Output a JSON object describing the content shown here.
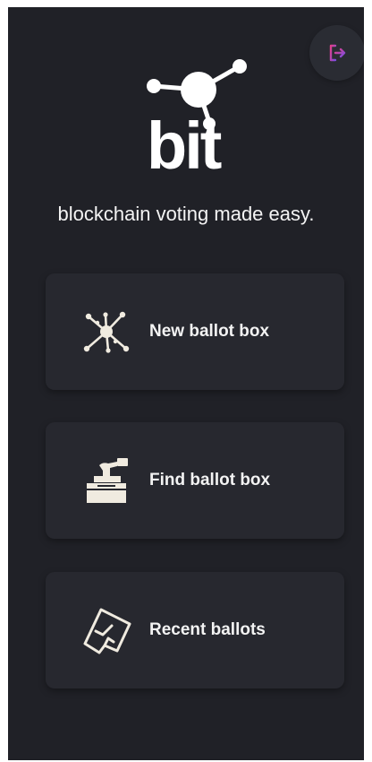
{
  "header": {
    "logout_icon": "logout-icon",
    "accent_colors": [
      "#e0408a",
      "#7b4de0"
    ]
  },
  "logo": {
    "text": "bit",
    "icon": "network-node-icon"
  },
  "tagline": "blockchain voting made easy.",
  "menu": {
    "items": [
      {
        "label": "New ballot box",
        "icon": "network-icon"
      },
      {
        "label": "Find ballot box",
        "icon": "ballot-box-icon"
      },
      {
        "label": "Recent ballots",
        "icon": "ballot-paper-icon"
      }
    ]
  },
  "colors": {
    "background": "#202127",
    "card": "#27282f",
    "text": "#f2f2f2"
  }
}
